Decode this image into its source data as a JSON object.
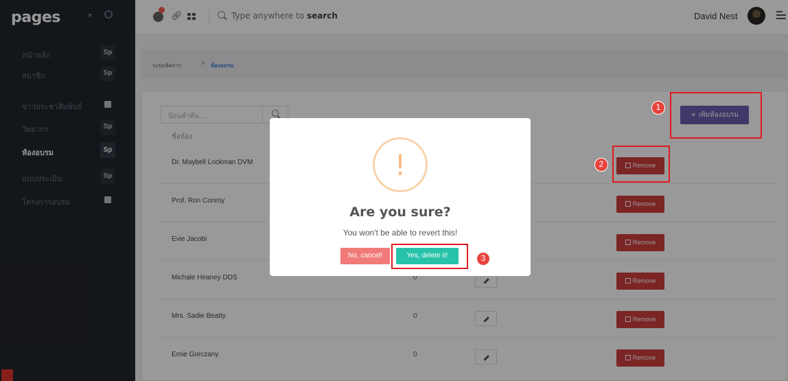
{
  "sidebar": {
    "brand": "pages",
    "items": [
      {
        "label": "หน้าหลัก",
        "badge": "Sp",
        "active": false
      },
      {
        "label": "สมาชิก",
        "badge": "Sp",
        "active": false
      },
      {
        "label": "ข่าวประชาสัมพันธ์",
        "badge": "",
        "active": false
      },
      {
        "label": "วิทยากร",
        "badge": "Sp",
        "active": false
      },
      {
        "label": "ห้องอบรม",
        "badge": "Sp",
        "active": true
      },
      {
        "label": "แบบประเมิน",
        "badge": "Sp",
        "active": false
      },
      {
        "label": "โครงการอบรม",
        "badge": "",
        "active": false
      }
    ]
  },
  "header": {
    "search_prefix": "Type anywhere to",
    "search_bold": "search",
    "user_name": "David Nest"
  },
  "breadcrumb": {
    "parent": "ระบบจัดการ",
    "separator": ">",
    "current": "ห้องอบรม"
  },
  "toolbar": {
    "filter_placeholder": "ป้อนคำค้น...",
    "add_button": "+ เพิ่มห้องอบรม"
  },
  "table": {
    "column_name": "ชื่อห้อง",
    "remove_label": "Remove",
    "rows": [
      {
        "name": "Dr. Maybell Lockman DVM",
        "count": ""
      },
      {
        "name": "Prof. Ron Conroy",
        "count": ""
      },
      {
        "name": "Evie Jacobi",
        "count": ""
      },
      {
        "name": "Michale Heaney DDS",
        "count": "0"
      },
      {
        "name": "Mrs. Sadie Beatty",
        "count": "0"
      },
      {
        "name": "Emie Gorczany",
        "count": "0"
      }
    ]
  },
  "modal": {
    "icon": "!",
    "title": "Are you sure?",
    "text": "You won't be able to revert this!",
    "cancel": "No, cancel!",
    "confirm": "Yes, delete it!"
  },
  "annotations": [
    "1",
    "2",
    "3"
  ],
  "colors": {
    "sidebar_bg": "#21252d",
    "add_button": "#6d5cae",
    "remove_button": "#cf3f3e",
    "confirm_button": "#27c2a8",
    "cancel_button": "#f07b78",
    "annotation_red": "#e0191f"
  }
}
